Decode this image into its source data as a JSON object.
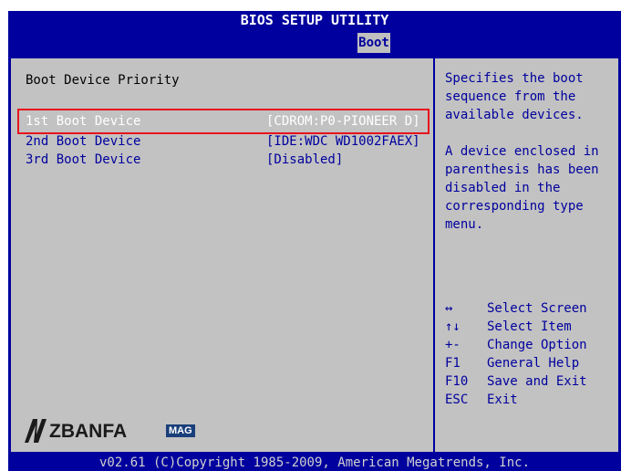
{
  "header": {
    "title": "BIOS SETUP UTILITY",
    "active_tab": "Boot"
  },
  "left": {
    "section_title": "Boot Device Priority",
    "rows": [
      {
        "label": "1st Boot Device",
        "value": "[CDROM:P0-PIONEER D]",
        "selected": true
      },
      {
        "label": "2nd Boot Device",
        "value": "[IDE:WDC WD1002FAEX]",
        "selected": false
      },
      {
        "label": "3rd Boot Device",
        "value": "[Disabled]",
        "selected": false
      }
    ]
  },
  "help": {
    "text": "Specifies the boot\nsequence from the\navailable devices.\n\nA device enclosed in\nparenthesis has been\ndisabled in the\ncorresponding type\nmenu.",
    "keys": [
      {
        "key": "↔",
        "desc": "Select Screen"
      },
      {
        "key": "↑↓",
        "desc": "Select Item"
      },
      {
        "key": "+-",
        "desc": "Change Option"
      },
      {
        "key": "F1",
        "desc": "General Help"
      },
      {
        "key": "F10",
        "desc": "Save and Exit"
      },
      {
        "key": "ESC",
        "desc": "Exit"
      }
    ]
  },
  "watermark": {
    "brand": "ZBANFA",
    "badge": "MAG"
  },
  "footer": {
    "text": "v02.61 (C)Copyright 1985-2009, American Megatrends, Inc."
  },
  "colors": {
    "background": "#00009e",
    "panel": "#c2c2c2",
    "highlight": "#e8141c"
  }
}
